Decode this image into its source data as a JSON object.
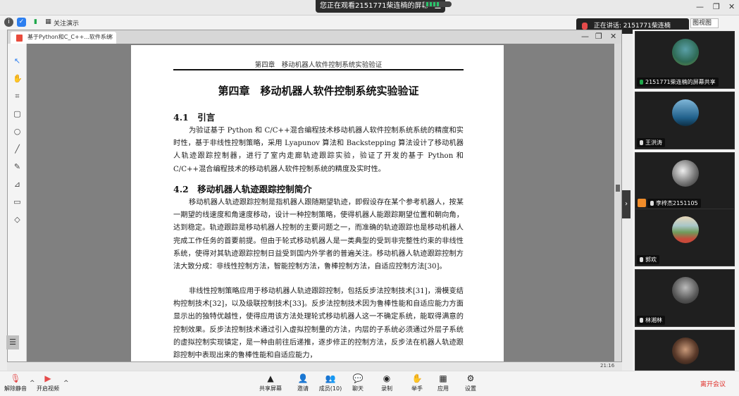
{
  "banner": {
    "text": "您正在观看2151771柴连楠的屏幕",
    "menu": "☰"
  },
  "meeting": {
    "view_label": "关注演示",
    "view_btn": "图视图",
    "speaking": "正在讲话: 2151771柴连楠"
  },
  "pdf": {
    "tab_title": "基于Python和C_C++...软件系统设计",
    "running_head": "第四章　移动机器人软件控制系统实验验证",
    "chapter_title": "第四章　移动机器人软件控制系统实验验证",
    "s1_title": "4.1　引言",
    "p1": "为验证基于 Python 和 C/C++混合编程技术移动机器人软件控制系统系统的精度和实时性，基于非线性控制策略，采用 Lyapunov 算法和 Backstepping 算法设计了移动机器人轨迹跟踪控制器，进行了室内走廊轨迹跟踪实验，验证了开发的基于 Python 和 C/C++混合编程技术的移动机器人软件控制系统的精度及实时性。",
    "s2_title": "4.2　移动机器人轨迹跟踪控制简介",
    "p2": "移动机器人轨迹跟踪控制是指机器人跟随期望轨迹，即假设存在某个参考机器人，按某一期望的线速度和角速度移动，设计一种控制策略，使得机器人能跟踪期望位置和朝向角，达到稳定。轨迹跟踪是移动机器人控制的主要问题之一，而准确的轨迹跟踪也是移动机器人完成工作任务的首要前提。但由于轮式移动机器人是一类典型的受到非完整性约束的非线性系统，使得对其轨迹跟踪控制日益受到国内外学者的普遍关注。移动机器人轨迹跟踪控制方法大致分成：非线性控制方法，智能控制方法，鲁棒控制方法，自适应控制方法[30]。",
    "p3": "非线性控制策略应用于移动机器人轨迹跟踪控制，包括反步法控制技术[31]，滑模变结构控制技术[32]，以及级联控制技术[33]。反步法控制技术因为鲁棒性能和自适应能力方面显示出的独特优越性，使得应用该方法处理轮式移动机器人这一不确定系统，能取得满意的控制效果。反步法控制技术通过引入虚拟控制量的方法，内层的子系统必须通过外层子系统的虚拟控制实现镇定，是一种由前往后递推，逐步修正的控制方法，反步法在机器人轨迹跟踪控制中表现出来的鲁棒性能和自适应能力，"
  },
  "gallery": [
    {
      "name": "2151771柴连楠的屏幕共享"
    },
    {
      "name": "王洪涛"
    },
    {
      "name": "李梓杰2151105"
    },
    {
      "name": "郭欢"
    },
    {
      "name": "林湘林"
    },
    {
      "name": ""
    }
  ],
  "taskbar": {
    "time": "21:16"
  },
  "bottom": {
    "mute": "解除静音",
    "video": "开启视频",
    "share": "共享屏幕",
    "invite": "邀请",
    "participants": "成员(10)",
    "chat": "聊天",
    "record": "录制",
    "raise": "举手",
    "apps": "应用",
    "settings": "设置",
    "leave": "离开会议"
  },
  "colors": {
    "accent_red": "#e0302a",
    "mic_red": "#e54b4b",
    "pdf_red": "#e94b3c"
  }
}
